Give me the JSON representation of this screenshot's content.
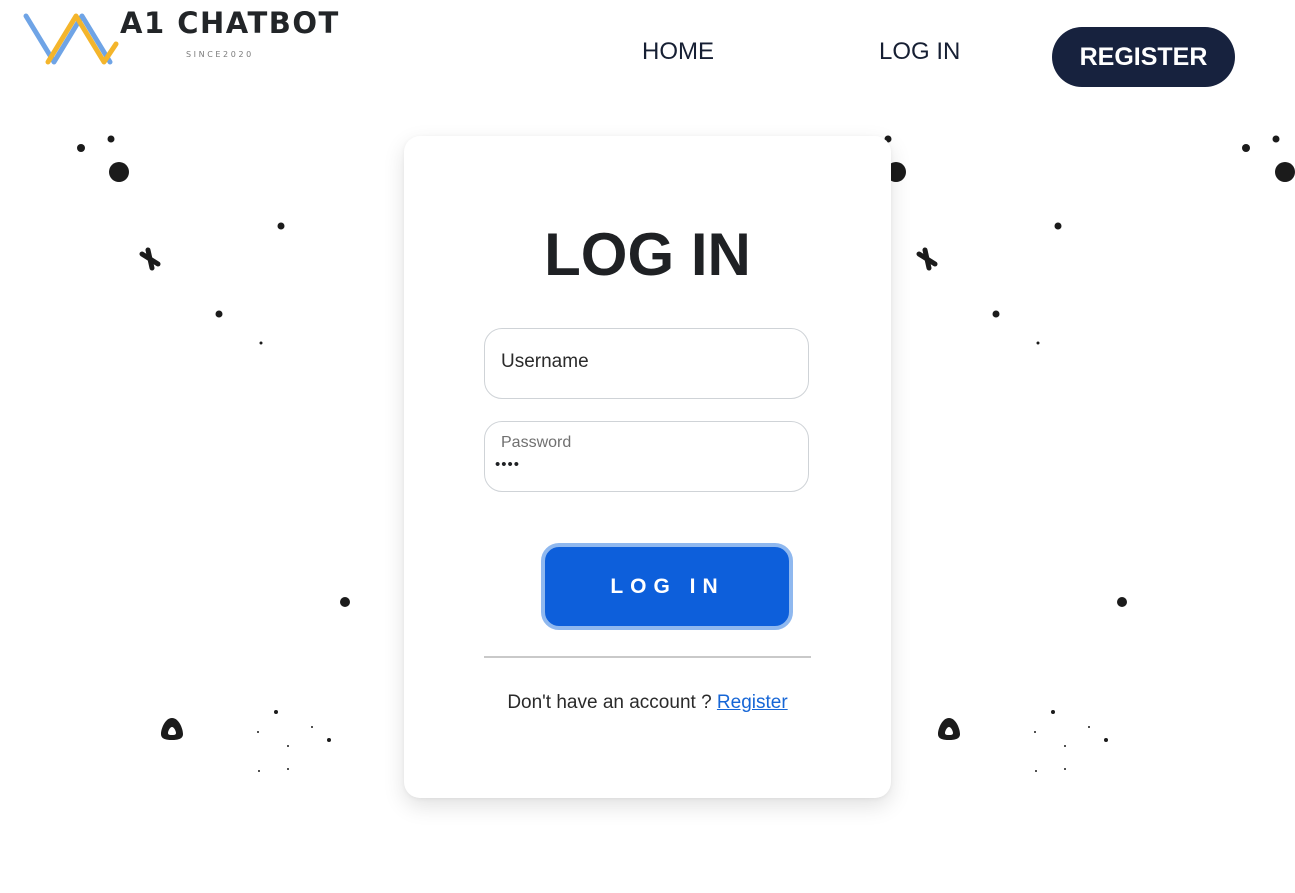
{
  "brand": {
    "name": "A1 CHATBOT",
    "tagline": "SINCE2020",
    "logo_icon": "a1-chatbot-logo-icon",
    "logo_colors": [
      "#6fa4e6",
      "#f4b52b"
    ]
  },
  "nav": {
    "home_label": "HOME",
    "login_label": "LOG IN",
    "register_label": "REGISTER"
  },
  "login_form": {
    "title": "LOG IN",
    "username_placeholder": "Username",
    "username_value": "",
    "password_label": "Password",
    "password_value": "••••",
    "submit_label": "LOG IN",
    "signup_prompt": "Don't have an account ?",
    "signup_link": "Register"
  },
  "colors": {
    "nav_register_bg": "#17223e",
    "submit_bg": "#0d5fdb",
    "submit_focus_ring": "#8fb8ef",
    "link": "#1666d6"
  },
  "decorations": {
    "icon": "sparkle-dots-decoration"
  }
}
